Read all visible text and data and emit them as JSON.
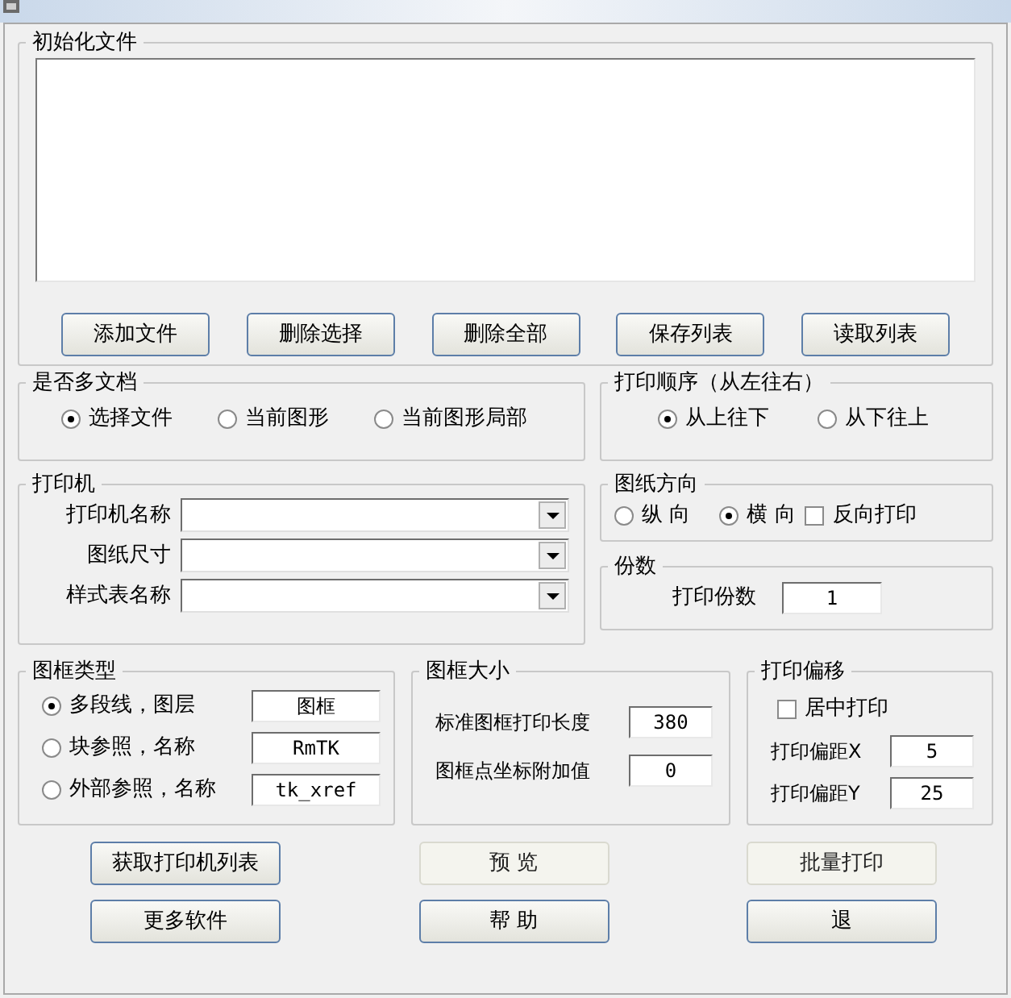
{
  "init_files": {
    "title": "初始化文件",
    "buttons": [
      {
        "label": "添加文件"
      },
      {
        "label": "删除选择"
      },
      {
        "label": "删除全部"
      },
      {
        "label": "保存列表"
      },
      {
        "label": "读取列表"
      }
    ]
  },
  "multi_doc": {
    "title": "是否多文档",
    "options": [
      {
        "label": "选择文件",
        "selected": true
      },
      {
        "label": "当前图形",
        "selected": false
      },
      {
        "label": "当前图形局部",
        "selected": false
      }
    ]
  },
  "print_order": {
    "title": "打印顺序（从左往右）",
    "options": [
      {
        "label": "从上往下",
        "selected": true
      },
      {
        "label": "从下往上",
        "selected": false
      }
    ]
  },
  "printer": {
    "title": "打印机",
    "fields": [
      {
        "label": "打印机名称"
      },
      {
        "label": "图纸尺寸"
      },
      {
        "label": "样式表名称"
      }
    ]
  },
  "orientation": {
    "title": "图纸方向",
    "options": [
      {
        "label": "纵 向",
        "selected": false
      },
      {
        "label": "横 向",
        "selected": true
      }
    ],
    "reverse": {
      "label": "反向打印",
      "checked": false
    }
  },
  "copies": {
    "title": "份数",
    "label": "打印份数",
    "value": "1"
  },
  "frame_type": {
    "title": "图框类型",
    "options": [
      {
        "label": "多段线，图层",
        "value": "图框",
        "selected": true
      },
      {
        "label": "块参照，名称",
        "value": "RmTK",
        "selected": false
      },
      {
        "label": "外部参照，名称",
        "value": "tk_xref",
        "selected": false
      }
    ]
  },
  "frame_size": {
    "title": "图框大小",
    "fields": [
      {
        "label": "标准图框打印长度",
        "value": "380"
      },
      {
        "label": "图框点坐标附加值",
        "value": "0"
      }
    ]
  },
  "offset": {
    "title": "打印偏移",
    "center": {
      "label": "居中打印",
      "checked": false
    },
    "fields": [
      {
        "label": "打印偏距X",
        "value": "5"
      },
      {
        "label": "打印偏距Y",
        "value": "25"
      }
    ]
  },
  "buttons": [
    {
      "label": "获取打印机列表",
      "disabled": false
    },
    {
      "label": "预 览",
      "disabled": true
    },
    {
      "label": "批量打印",
      "disabled": true
    },
    {
      "label": "更多软件",
      "disabled": false
    },
    {
      "label": "帮 助",
      "disabled": false
    },
    {
      "label": "退",
      "disabled": false
    }
  ]
}
